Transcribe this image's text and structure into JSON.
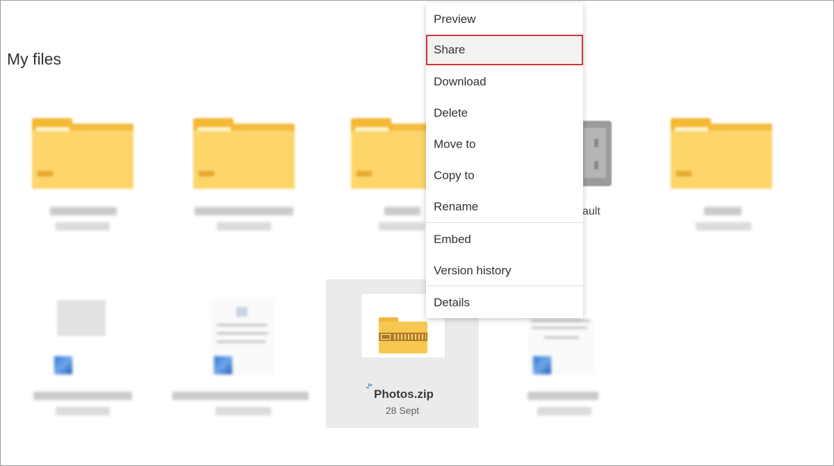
{
  "page": {
    "title": "My files"
  },
  "vault": {
    "label_fragment": "ault"
  },
  "selected_file": {
    "name": "Photos.zip",
    "date": "28 Sept"
  },
  "context_menu": {
    "items": [
      {
        "label": "Preview"
      },
      {
        "label": "Share",
        "highlighted": true
      },
      {
        "label": "Download"
      },
      {
        "label": "Delete"
      },
      {
        "label": "Move to"
      },
      {
        "label": "Copy to"
      },
      {
        "label": "Rename"
      },
      {
        "label": "Embed"
      },
      {
        "label": "Version history"
      },
      {
        "label": "Details"
      }
    ]
  },
  "colors": {
    "highlight_border": "#d13438",
    "folder": "#fdd56b",
    "selection_background": "#ebebeb"
  },
  "icons": [
    "folder-icon",
    "personal-vault-icon",
    "zip-folder-icon",
    "sync-spinner-icon",
    "word-document-icon"
  ]
}
